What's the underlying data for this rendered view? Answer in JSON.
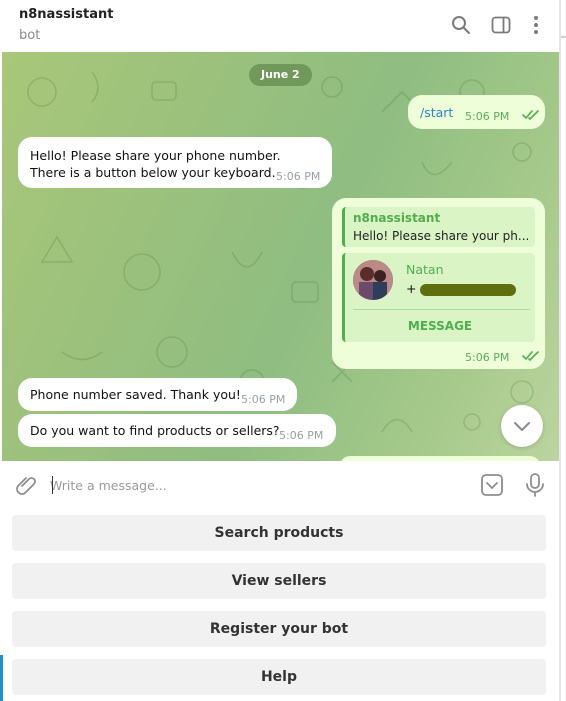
{
  "header": {
    "chat_name": "n8nassistant",
    "status": "bot",
    "icons": [
      "search-icon",
      "sidebar-toggle-icon",
      "more-vertical-icon"
    ]
  },
  "chat": {
    "date_label": "June 2",
    "messages": [
      {
        "direction": "outgoing",
        "text": "/start",
        "time": "5:06 PM",
        "read": true
      },
      {
        "direction": "incoming",
        "text_line1": "Hello! Please share your phone number.",
        "text_line2": "There is a button below your keyboard.",
        "time": "5:06 PM"
      },
      {
        "direction": "outgoing",
        "type": "contact",
        "reply_author": "n8nassistant",
        "reply_text": "Hello! Please share your ph...",
        "contact_name": "Natan",
        "contact_phone": "+",
        "contact_action": "MESSAGE",
        "time": "5:06 PM",
        "read": true
      },
      {
        "direction": "incoming",
        "text": "Phone number saved. Thank you!",
        "time": "5:06 PM"
      },
      {
        "direction": "incoming",
        "text": "Do you want to find products or sellers?",
        "time": "5:06 PM"
      }
    ]
  },
  "composer": {
    "placeholder": "Write a message...",
    "icons": [
      "attach-icon",
      "bot-keyboard-icon",
      "microphone-icon"
    ]
  },
  "keyboard": {
    "buttons": [
      "Search products",
      "View sellers",
      "Register your bot",
      "Help"
    ]
  },
  "colors": {
    "outgoing_bubble": "#eefed8",
    "incoming_bubble": "#ffffff",
    "accent_green": "#4fae4e",
    "date_pill": "#6f9a58"
  }
}
